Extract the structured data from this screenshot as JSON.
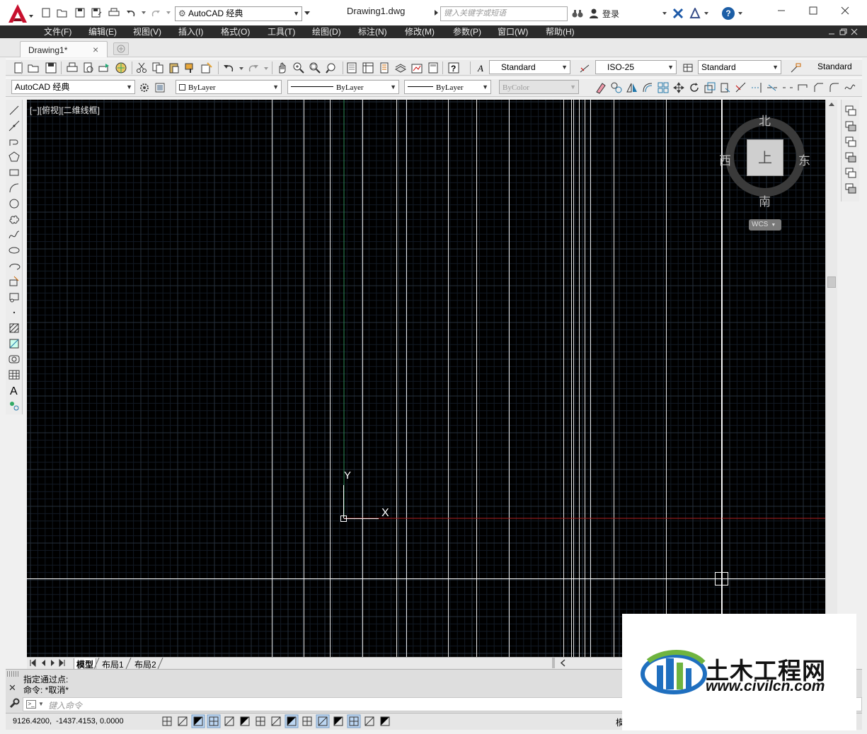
{
  "app": {
    "doc_title": "Drawing1.dwg",
    "workspace": "AutoCAD 经典",
    "search_placeholder": "键入关键字或短语",
    "login_label": "登录",
    "help_label": "?"
  },
  "menu": {
    "items": [
      "文件(F)",
      "编辑(E)",
      "视图(V)",
      "插入(I)",
      "格式(O)",
      "工具(T)",
      "绘图(D)",
      "标注(N)",
      "修改(M)",
      "参数(P)",
      "窗口(W)",
      "帮助(H)"
    ]
  },
  "tabs": {
    "doc_tab": "Drawing1*",
    "close_glyph": "×"
  },
  "styles_toolbar": {
    "text_style": "Standard",
    "dim_style": "ISO-25",
    "table_style": "Standard",
    "mleader_style": "Standard"
  },
  "layers_toolbar": {
    "workspace": "AutoCAD 经典",
    "layer": "ByLayer",
    "linetype": "ByLayer",
    "lineweight": "ByLayer",
    "color": "ByColor"
  },
  "viewport": {
    "label": "[−][俯视][二维线框]",
    "background": "#000000",
    "ucs_y": "Y",
    "ucs_x": "X"
  },
  "viewcube": {
    "north": "北",
    "south": "南",
    "west": "西",
    "east": "东",
    "top": "上",
    "wcs": "WCS"
  },
  "layout_tabs": [
    "模型",
    "布局1",
    "布局2"
  ],
  "command": {
    "history": [
      "指定通过点:",
      "命令: *取消*"
    ],
    "placeholder": "键入命令"
  },
  "status": {
    "coordinates": "9126.4200,  -1437.4153, 0.0000",
    "model_label": "模"
  },
  "watermark": {
    "name": "土木工程网",
    "url": "www.civilcn.com"
  },
  "colors": {
    "accent_red": "#c8102e",
    "menubar": "#2b2b2b",
    "canvas": "#000000",
    "x_axis": "#b22222",
    "y_axis": "#2e8b57",
    "logo_blue": "#1f6fbf",
    "logo_green": "#6fb43f"
  }
}
